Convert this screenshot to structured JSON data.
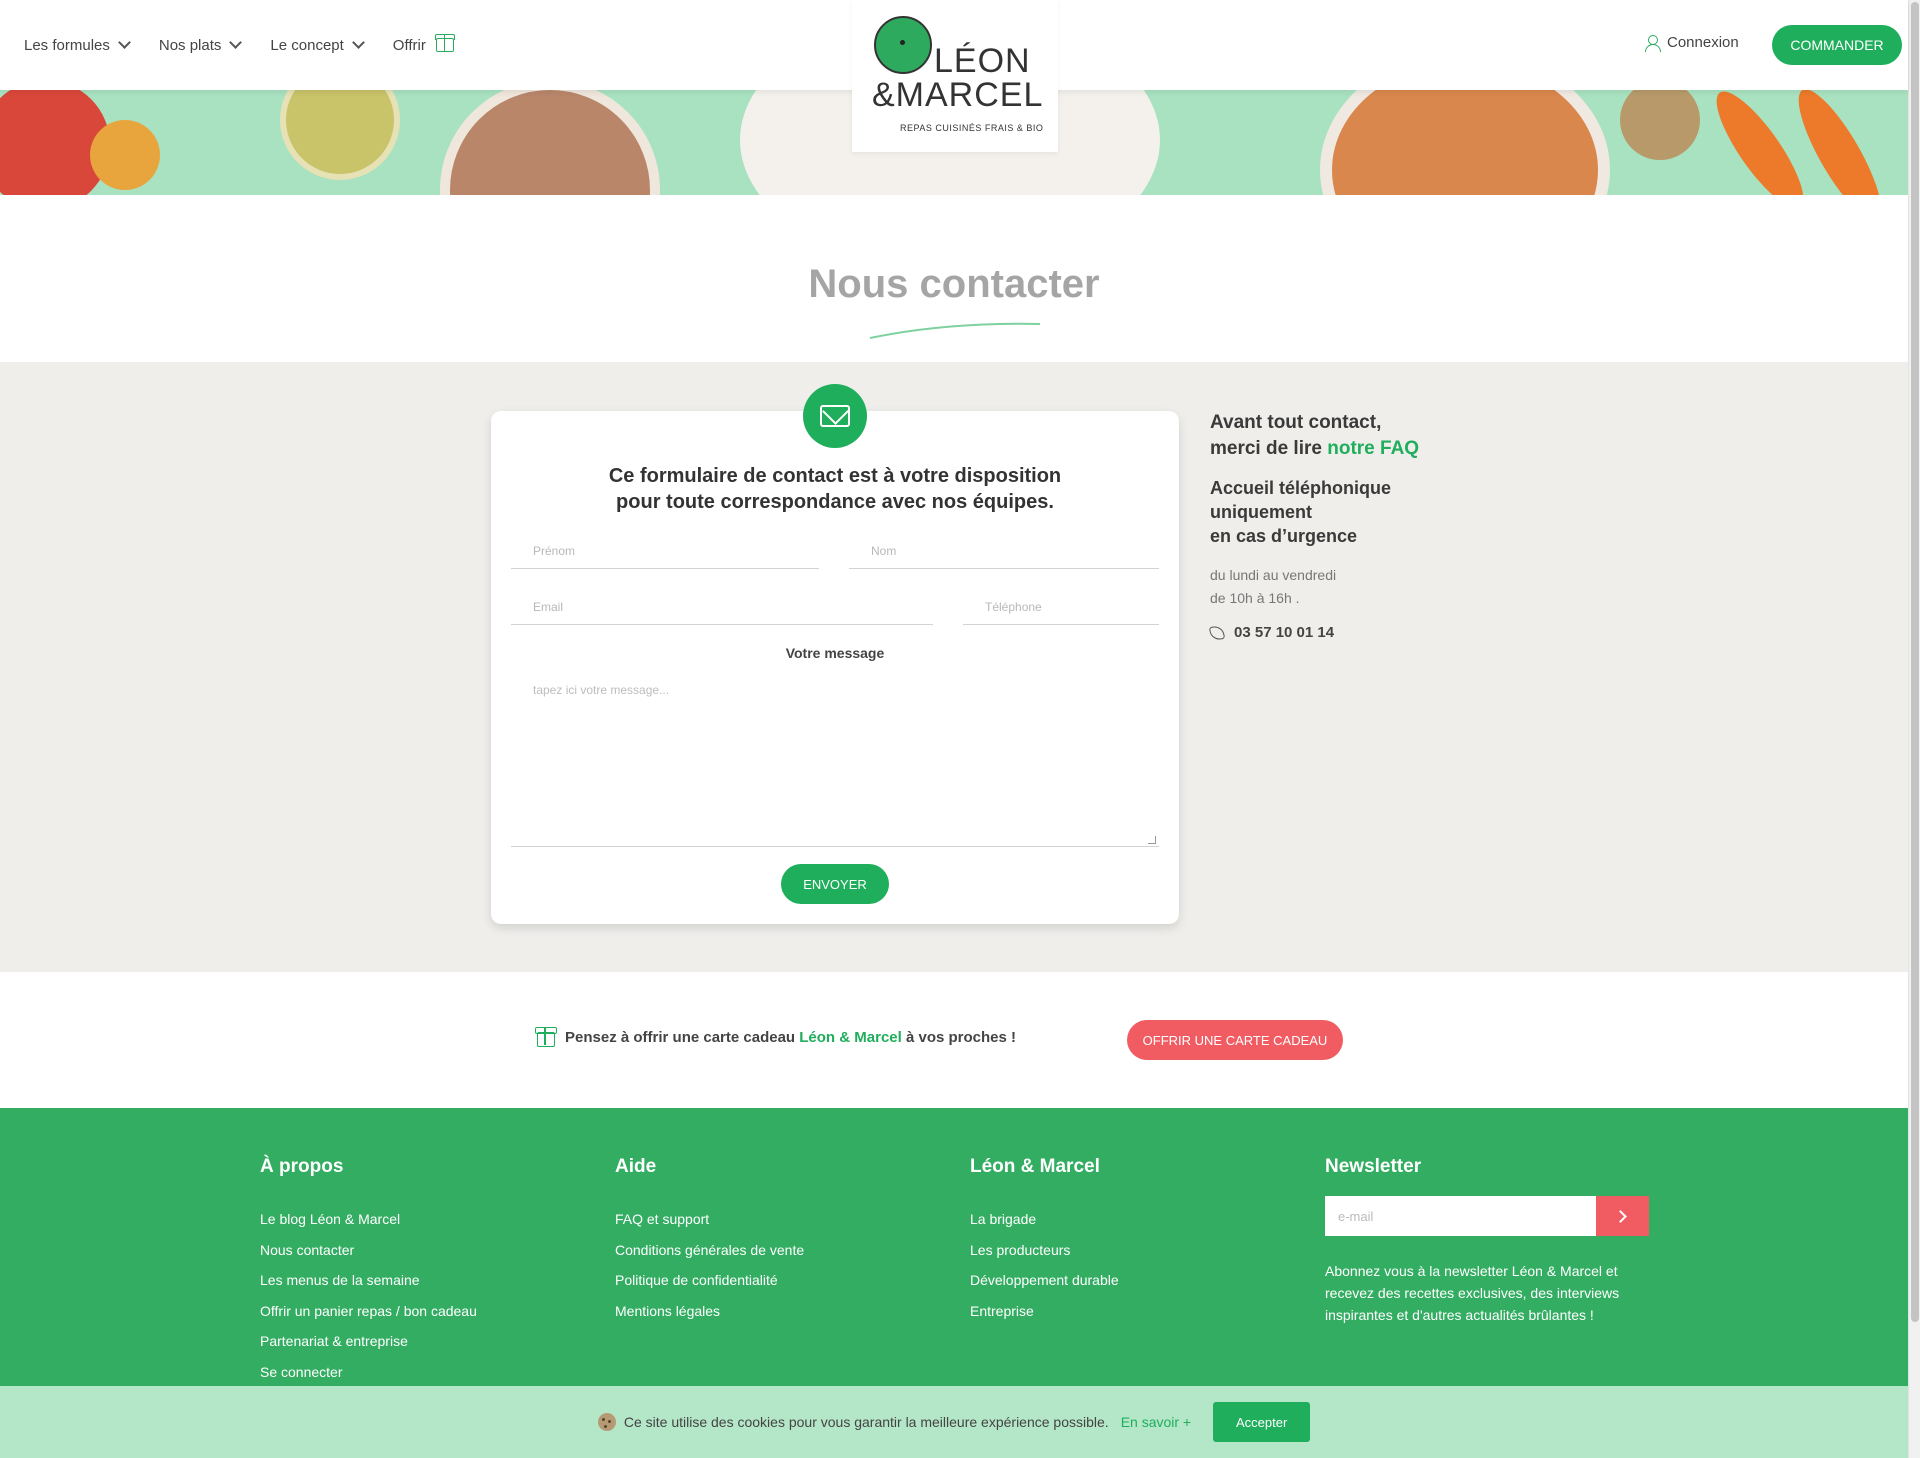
{
  "header": {
    "nav": [
      {
        "label": "Les formules"
      },
      {
        "label": "Nos plats"
      },
      {
        "label": "Le concept"
      },
      {
        "label": "Offrir"
      }
    ],
    "logo": {
      "line1": "LÉON",
      "line2": "&MARCEL",
      "tagline": "REPAS CUISINÉS FRAIS & BIO"
    },
    "login_label": "Connexion",
    "order_label": "COMMANDER"
  },
  "page": {
    "title": "Nous contacter"
  },
  "form": {
    "title_line1": "Ce formulaire de contact est à votre disposition",
    "title_line2": "pour toute correspondance avec nos équipes.",
    "firstname_placeholder": "Prénom",
    "lastname_placeholder": "Nom",
    "email_placeholder": "Email",
    "phone_placeholder": "Téléphone",
    "message_label": "Votre message",
    "message_placeholder": "tapez ici votre message...",
    "submit_label": "ENVOYER"
  },
  "side": {
    "line1": "Avant tout contact,",
    "line2_prefix": "merci de lire ",
    "faq_link": "notre FAQ",
    "urgent_line1": "Accueil téléphonique",
    "urgent_line2": "uniquement",
    "urgent_line3": "en cas d’urgence",
    "hours_line1": "du lundi au vendredi",
    "hours_line2": "de 10h à 16h .",
    "phone": "03 57 10 01 14"
  },
  "gift": {
    "text_prefix": "Pensez à offrir une carte cadeau ",
    "brand": "Léon & Marcel",
    "text_suffix": " à vos proches !",
    "button_label": "OFFRIR UNE CARTE CADEAU"
  },
  "footer": {
    "about": {
      "title": "À propos",
      "links": [
        "Le blog Léon & Marcel",
        "Nous contacter",
        "Les menus de la semaine",
        "Offrir un panier repas / bon cadeau",
        "Partenariat & entreprise",
        "Se connecter"
      ]
    },
    "help": {
      "title": "Aide",
      "links": [
        "FAQ et support",
        "Conditions générales de vente",
        "Politique de confidentialité",
        "Mentions légales"
      ]
    },
    "brand": {
      "title": "Léon & Marcel",
      "links": [
        "La brigade",
        "Les producteurs",
        "Développement durable",
        "Entreprise"
      ]
    },
    "newsletter": {
      "title": "Newsletter",
      "placeholder": "e-mail",
      "text": "Abonnez vous à la newsletter Léon & Marcel et recevez des recettes exclusives, des interviews inspirantes et d'autres actualités brûlantes !"
    }
  },
  "cookie": {
    "text": "Ce site utilise des cookies pour vous garantir la meilleure expérience possible.",
    "more": "En savoir +",
    "accept": "Accepter"
  },
  "colors": {
    "brand_green": "#1fae5c",
    "footer_green": "#33ad62",
    "coral": "#f15c63",
    "banner_mint": "#a8e2c0"
  }
}
